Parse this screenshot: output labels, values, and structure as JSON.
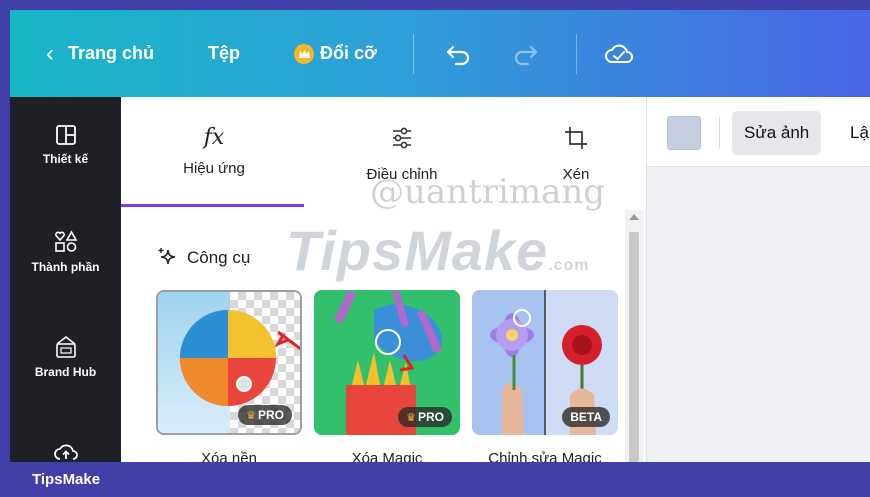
{
  "topbar": {
    "back_label": "Trang chủ",
    "file_label": "Tệp",
    "resize_label": "Đổi cỡ",
    "colors": {
      "gradient_start": "#18b7c6",
      "gradient_end": "#4a66e6",
      "crown": "#f6b729"
    }
  },
  "rail": {
    "items": [
      {
        "label": "Thiết kế",
        "icon": "layout-icon"
      },
      {
        "label": "Thành phần",
        "icon": "shapes-icon"
      },
      {
        "label": "Brand Hub",
        "icon": "brand-hub-icon"
      },
      {
        "label": "",
        "icon": "upload-cloud-icon"
      }
    ]
  },
  "panel": {
    "tabs": [
      {
        "label": "Hiệu ứng",
        "icon": "fx-icon",
        "active": true
      },
      {
        "label": "Điều chỉnh",
        "icon": "sliders-icon",
        "active": false
      },
      {
        "label": "Xén",
        "icon": "crop-icon",
        "active": false
      }
    ],
    "section_title": "Công cụ",
    "cards": [
      {
        "label": "Xóa nền",
        "badge": "PRO",
        "badge_crown": true
      },
      {
        "label": "Xóa Magic",
        "badge": "PRO",
        "badge_crown": true
      },
      {
        "label": "Chỉnh sửa Magic",
        "badge": "BETA",
        "badge_crown": false
      }
    ],
    "accent_color": "#7d3af2"
  },
  "right": {
    "edit_photo_label": "Sửa ảnh",
    "next_label_partial": "Lậ",
    "swatch_color": "#c3cfdf"
  },
  "watermarks": {
    "tipsmake_main": "TipsMake",
    "tipsmake_com": ".com",
    "quantrimang": "@uantrimang"
  },
  "footer": {
    "brand": "TipsMake"
  }
}
